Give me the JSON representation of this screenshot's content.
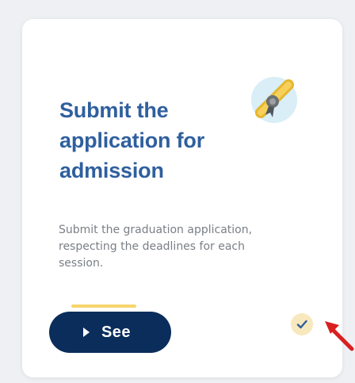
{
  "card": {
    "title": "Submit the application for admission",
    "description": "Submit the graduation application, respecting the deadlines for each session.",
    "action_label": "See",
    "icons": {
      "badge": "graduation-medal-icon",
      "button": "play-icon",
      "status": "check-icon",
      "annotation": "red-arrow-icon"
    },
    "colors": {
      "title": "#2f5f9e",
      "button": "#0b2d5b",
      "accent": "#f5cb47",
      "annotation": "#d91f1f"
    }
  }
}
